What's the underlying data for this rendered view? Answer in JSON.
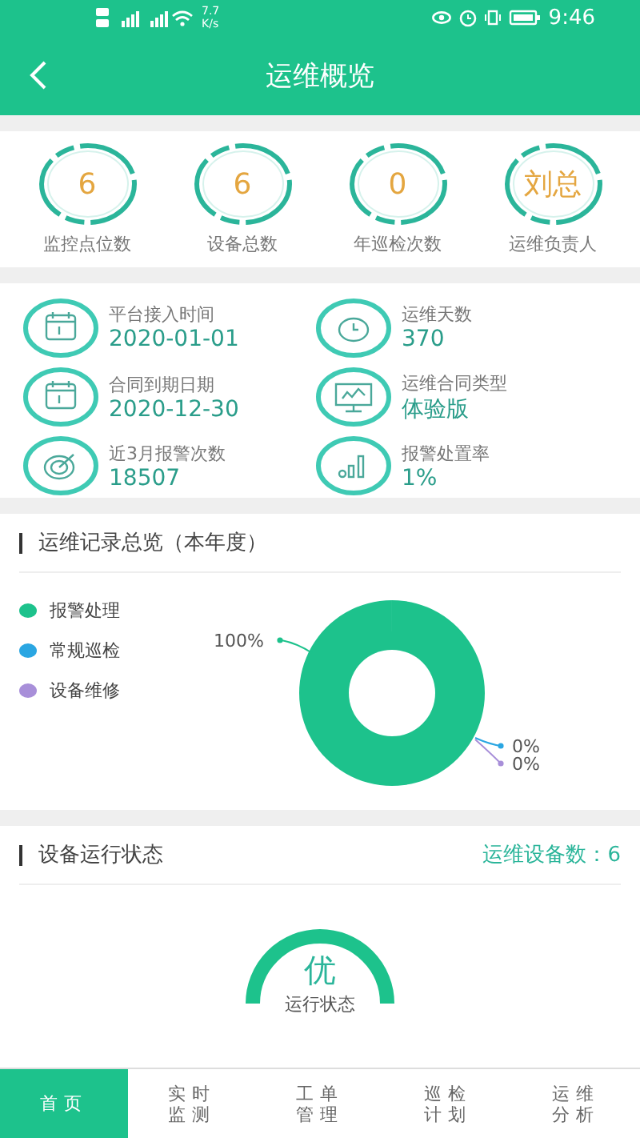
{
  "status_bar": {
    "speed": "7.7",
    "speed_unit": "K/s",
    "time": "9:46"
  },
  "header": {
    "title": "运维概览"
  },
  "stats": [
    {
      "value": "6",
      "label": "监控点位数"
    },
    {
      "value": "6",
      "label": "设备总数"
    },
    {
      "value": "0",
      "label": "年巡检次数"
    },
    {
      "value": "刘总",
      "label": "运维负责人"
    }
  ],
  "info": [
    {
      "label": "平台接入时间",
      "value": "2020-01-01"
    },
    {
      "label": "运维天数",
      "value": "370"
    },
    {
      "label": "合同到期日期",
      "value": "2020-12-30"
    },
    {
      "label": "运维合同类型",
      "value": "体验版"
    },
    {
      "label": "近3月报警次数",
      "value": "18507"
    },
    {
      "label": "报警处置率",
      "value": "1%"
    }
  ],
  "records": {
    "title": "运维记录总览（本年度）",
    "chart_data": {
      "type": "donut",
      "categories": [
        "报警处理",
        "常规巡检",
        "设备维修"
      ],
      "values": [
        100,
        0,
        0
      ],
      "colors": [
        "#1dc28c",
        "#2aa6e2",
        "#a88fd9"
      ],
      "value_labels": [
        "100%",
        "0%",
        "0%"
      ]
    }
  },
  "device_status": {
    "title": "设备运行状态",
    "count_label": "运维设备数：6",
    "grade": "优",
    "grade_label": "运行状态"
  },
  "tabs": [
    {
      "label": "首页",
      "selected": true
    },
    {
      "label": "实时监测",
      "selected": false
    },
    {
      "label": "工单管理",
      "selected": false
    },
    {
      "label": "巡检计划",
      "selected": false
    },
    {
      "label": "运维分析",
      "selected": false
    }
  ]
}
